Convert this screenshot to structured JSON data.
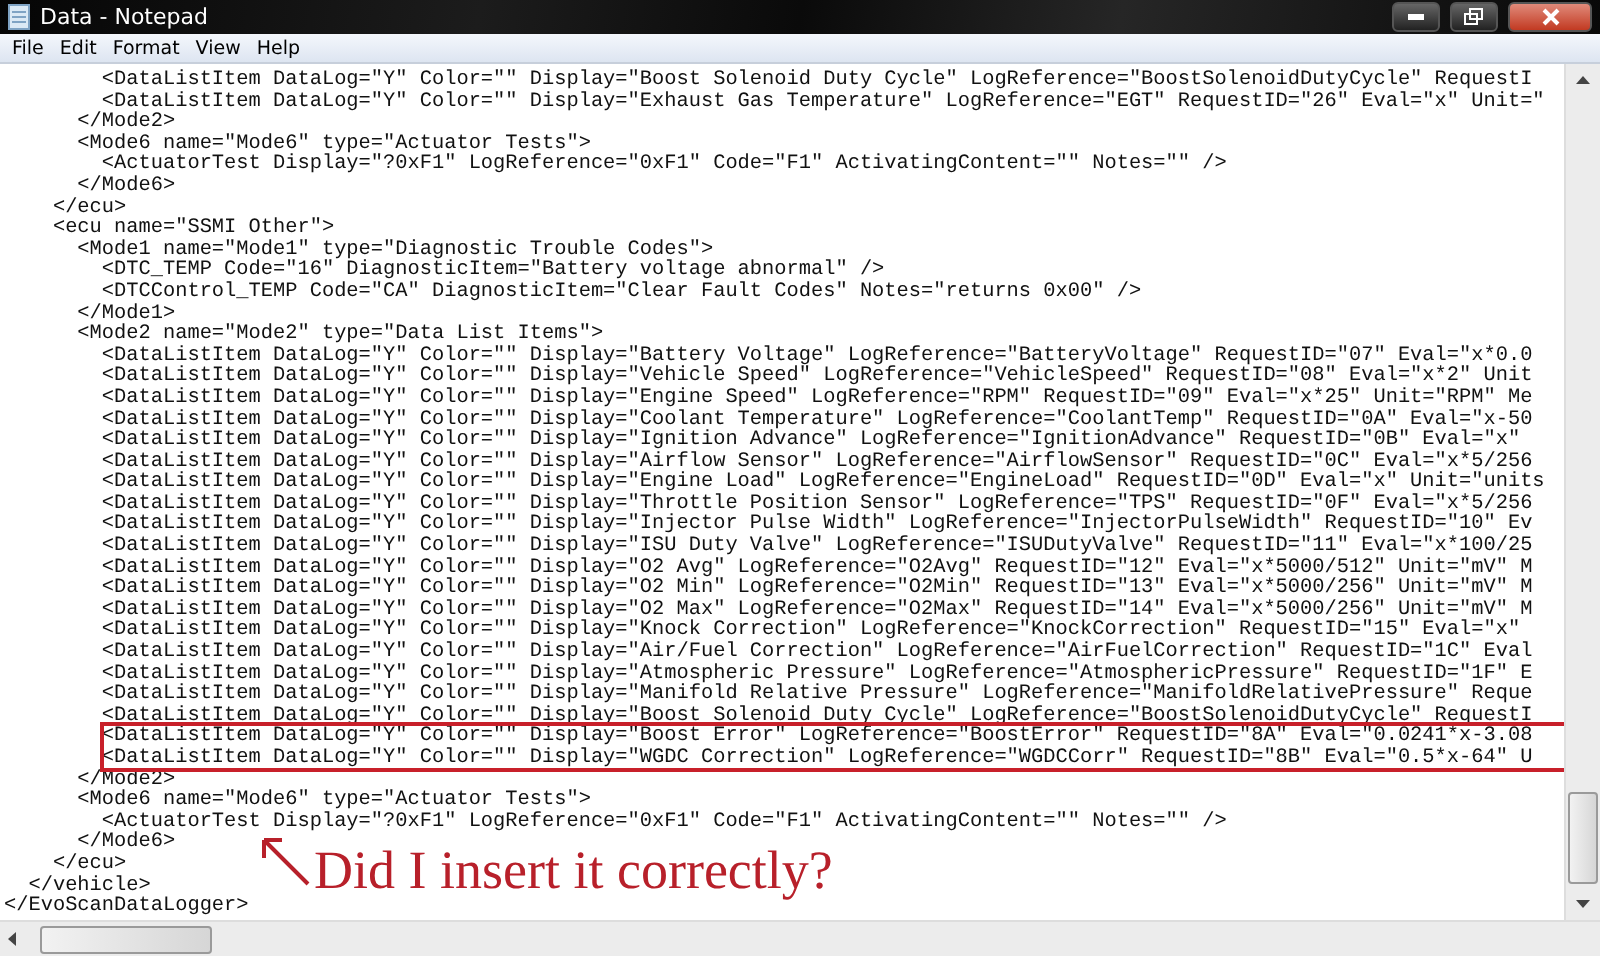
{
  "window": {
    "title": "Data - Notepad"
  },
  "menu": [
    "File",
    "Edit",
    "Format",
    "View",
    "Help"
  ],
  "lines": [
    {
      "text": "        <DataListItem DataLog=\"Y\" Color=\"\" Display=\"Boost Solenoid Duty Cycle\" LogReference=\"BoostSolenoidDutyCycle\" RequestI",
      "highlighted": false
    },
    {
      "text": "        <DataListItem DataLog=\"Y\" Color=\"\" Display=\"Exhaust Gas Temperature\" LogReference=\"EGT\" RequestID=\"26\" Eval=\"x\" Unit=\"",
      "highlighted": false
    },
    {
      "text": "      </Mode2>",
      "highlighted": false
    },
    {
      "text": "      <Mode6 name=\"Mode6\" type=\"Actuator Tests\">",
      "highlighted": false
    },
    {
      "text": "        <ActuatorTest Display=\"?0xF1\" LogReference=\"0xF1\" Code=\"F1\" ActivatingContent=\"\" Notes=\"\" />",
      "highlighted": false
    },
    {
      "text": "      </Mode6>",
      "highlighted": false
    },
    {
      "text": "    </ecu>",
      "highlighted": false
    },
    {
      "text": "    <ecu name=\"SSMI Other\">",
      "highlighted": false
    },
    {
      "text": "      <Mode1 name=\"Mode1\" type=\"Diagnostic Trouble Codes\">",
      "highlighted": false
    },
    {
      "text": "        <DTC_TEMP Code=\"16\" DiagnosticItem=\"Battery voltage abnormal\" />",
      "highlighted": false
    },
    {
      "text": "        <DTCControl_TEMP Code=\"CA\" DiagnosticItem=\"Clear Fault Codes\" Notes=\"returns 0x00\" />",
      "highlighted": false
    },
    {
      "text": "      </Mode1>",
      "highlighted": false
    },
    {
      "text": "      <Mode2 name=\"Mode2\" type=\"Data List Items\">",
      "highlighted": false
    },
    {
      "text": "        <DataListItem DataLog=\"Y\" Color=\"\" Display=\"Battery Voltage\" LogReference=\"BatteryVoltage\" RequestID=\"07\" Eval=\"x*0.0",
      "highlighted": false
    },
    {
      "text": "        <DataListItem DataLog=\"Y\" Color=\"\" Display=\"Vehicle Speed\" LogReference=\"VehicleSpeed\" RequestID=\"08\" Eval=\"x*2\" Unit",
      "highlighted": false
    },
    {
      "text": "        <DataListItem DataLog=\"Y\" Color=\"\" Display=\"Engine Speed\" LogReference=\"RPM\" RequestID=\"09\" Eval=\"x*25\" Unit=\"RPM\" Me",
      "highlighted": false
    },
    {
      "text": "        <DataListItem DataLog=\"Y\" Color=\"\" Display=\"Coolant Temperature\" LogReference=\"CoolantTemp\" RequestID=\"0A\" Eval=\"x-50",
      "highlighted": false
    },
    {
      "text": "        <DataListItem DataLog=\"Y\" Color=\"\" Display=\"Ignition Advance\" LogReference=\"IgnitionAdvance\" RequestID=\"0B\" Eval=\"x\"",
      "highlighted": false
    },
    {
      "text": "        <DataListItem DataLog=\"Y\" Color=\"\" Display=\"Airflow Sensor\" LogReference=\"AirflowSensor\" RequestID=\"0C\" Eval=\"x*5/256",
      "highlighted": false
    },
    {
      "text": "        <DataListItem DataLog=\"Y\" Color=\"\" Display=\"Engine Load\" LogReference=\"EngineLoad\" RequestID=\"0D\" Eval=\"x\" Unit=\"units",
      "highlighted": false
    },
    {
      "text": "        <DataListItem DataLog=\"Y\" Color=\"\" Display=\"Throttle Position Sensor\" LogReference=\"TPS\" RequestID=\"0F\" Eval=\"x*5/256",
      "highlighted": false
    },
    {
      "text": "        <DataListItem DataLog=\"Y\" Color=\"\" Display=\"Injector Pulse Width\" LogReference=\"InjectorPulseWidth\" RequestID=\"10\" Ev",
      "highlighted": false
    },
    {
      "text": "        <DataListItem DataLog=\"Y\" Color=\"\" Display=\"ISU Duty Valve\" LogReference=\"ISUDutyValve\" RequestID=\"11\" Eval=\"x*100/25",
      "highlighted": false
    },
    {
      "text": "        <DataListItem DataLog=\"Y\" Color=\"\" Display=\"O2 Avg\" LogReference=\"O2Avg\" RequestID=\"12\" Eval=\"x*5000/512\" Unit=\"mV\" M",
      "highlighted": false
    },
    {
      "text": "        <DataListItem DataLog=\"Y\" Color=\"\" Display=\"O2 Min\" LogReference=\"O2Min\" RequestID=\"13\" Eval=\"x*5000/256\" Unit=\"mV\" M",
      "highlighted": false
    },
    {
      "text": "        <DataListItem DataLog=\"Y\" Color=\"\" Display=\"O2 Max\" LogReference=\"O2Max\" RequestID=\"14\" Eval=\"x*5000/256\" Unit=\"mV\" M",
      "highlighted": false
    },
    {
      "text": "        <DataListItem DataLog=\"Y\" Color=\"\" Display=\"Knock Correction\" LogReference=\"KnockCorrection\" RequestID=\"15\" Eval=\"x\"",
      "highlighted": false
    },
    {
      "text": "        <DataListItem DataLog=\"Y\" Color=\"\" Display=\"Air/Fuel Correction\" LogReference=\"AirFuelCorrection\" RequestID=\"1C\" Eval",
      "highlighted": false
    },
    {
      "text": "        <DataListItem DataLog=\"Y\" Color=\"\" Display=\"Atmospheric Pressure\" LogReference=\"AtmosphericPressure\" RequestID=\"1F\" E",
      "highlighted": false
    },
    {
      "text": "        <DataListItem DataLog=\"Y\" Color=\"\" Display=\"Manifold Relative Pressure\" LogReference=\"ManifoldRelativePressure\" Reque",
      "highlighted": false
    },
    {
      "text": "        <DataListItem DataLog=\"Y\" Color=\"\" Display=\"Boost Solenoid Duty Cycle\" LogReference=\"BoostSolenoidDutyCycle\" RequestI",
      "highlighted": false
    },
    {
      "text": "        <DataListItem DataLog=\"Y\" Color=\"\" Display=\"Boost Error\" LogReference=\"BoostError\" RequestID=\"8A\" Eval=\"0.0241*x-3.08",
      "highlighted": true
    },
    {
      "text": "        <DataListItem DataLog=\"Y\" Color=\"\" Display=\"WGDC Correction\" LogReference=\"WGDCCorr\" RequestID=\"8B\" Eval=\"0.5*x-64\" U",
      "highlighted": true
    },
    {
      "text": "      </Mode2>",
      "highlighted": false
    },
    {
      "text": "      <Mode6 name=\"Mode6\" type=\"Actuator Tests\">",
      "highlighted": false
    },
    {
      "text": "        <ActuatorTest Display=\"?0xF1\" LogReference=\"0xF1\" Code=\"F1\" ActivatingContent=\"\" Notes=\"\" />",
      "highlighted": false
    },
    {
      "text": "      </Mode6>",
      "highlighted": false
    },
    {
      "text": "    </ecu>",
      "highlighted": false
    },
    {
      "text": "  </vehicle>",
      "highlighted": false
    },
    {
      "text": "</EvoScanDataLogger>",
      "highlighted": false
    }
  ],
  "annotation": {
    "text": "Did I insert it correctly?"
  }
}
